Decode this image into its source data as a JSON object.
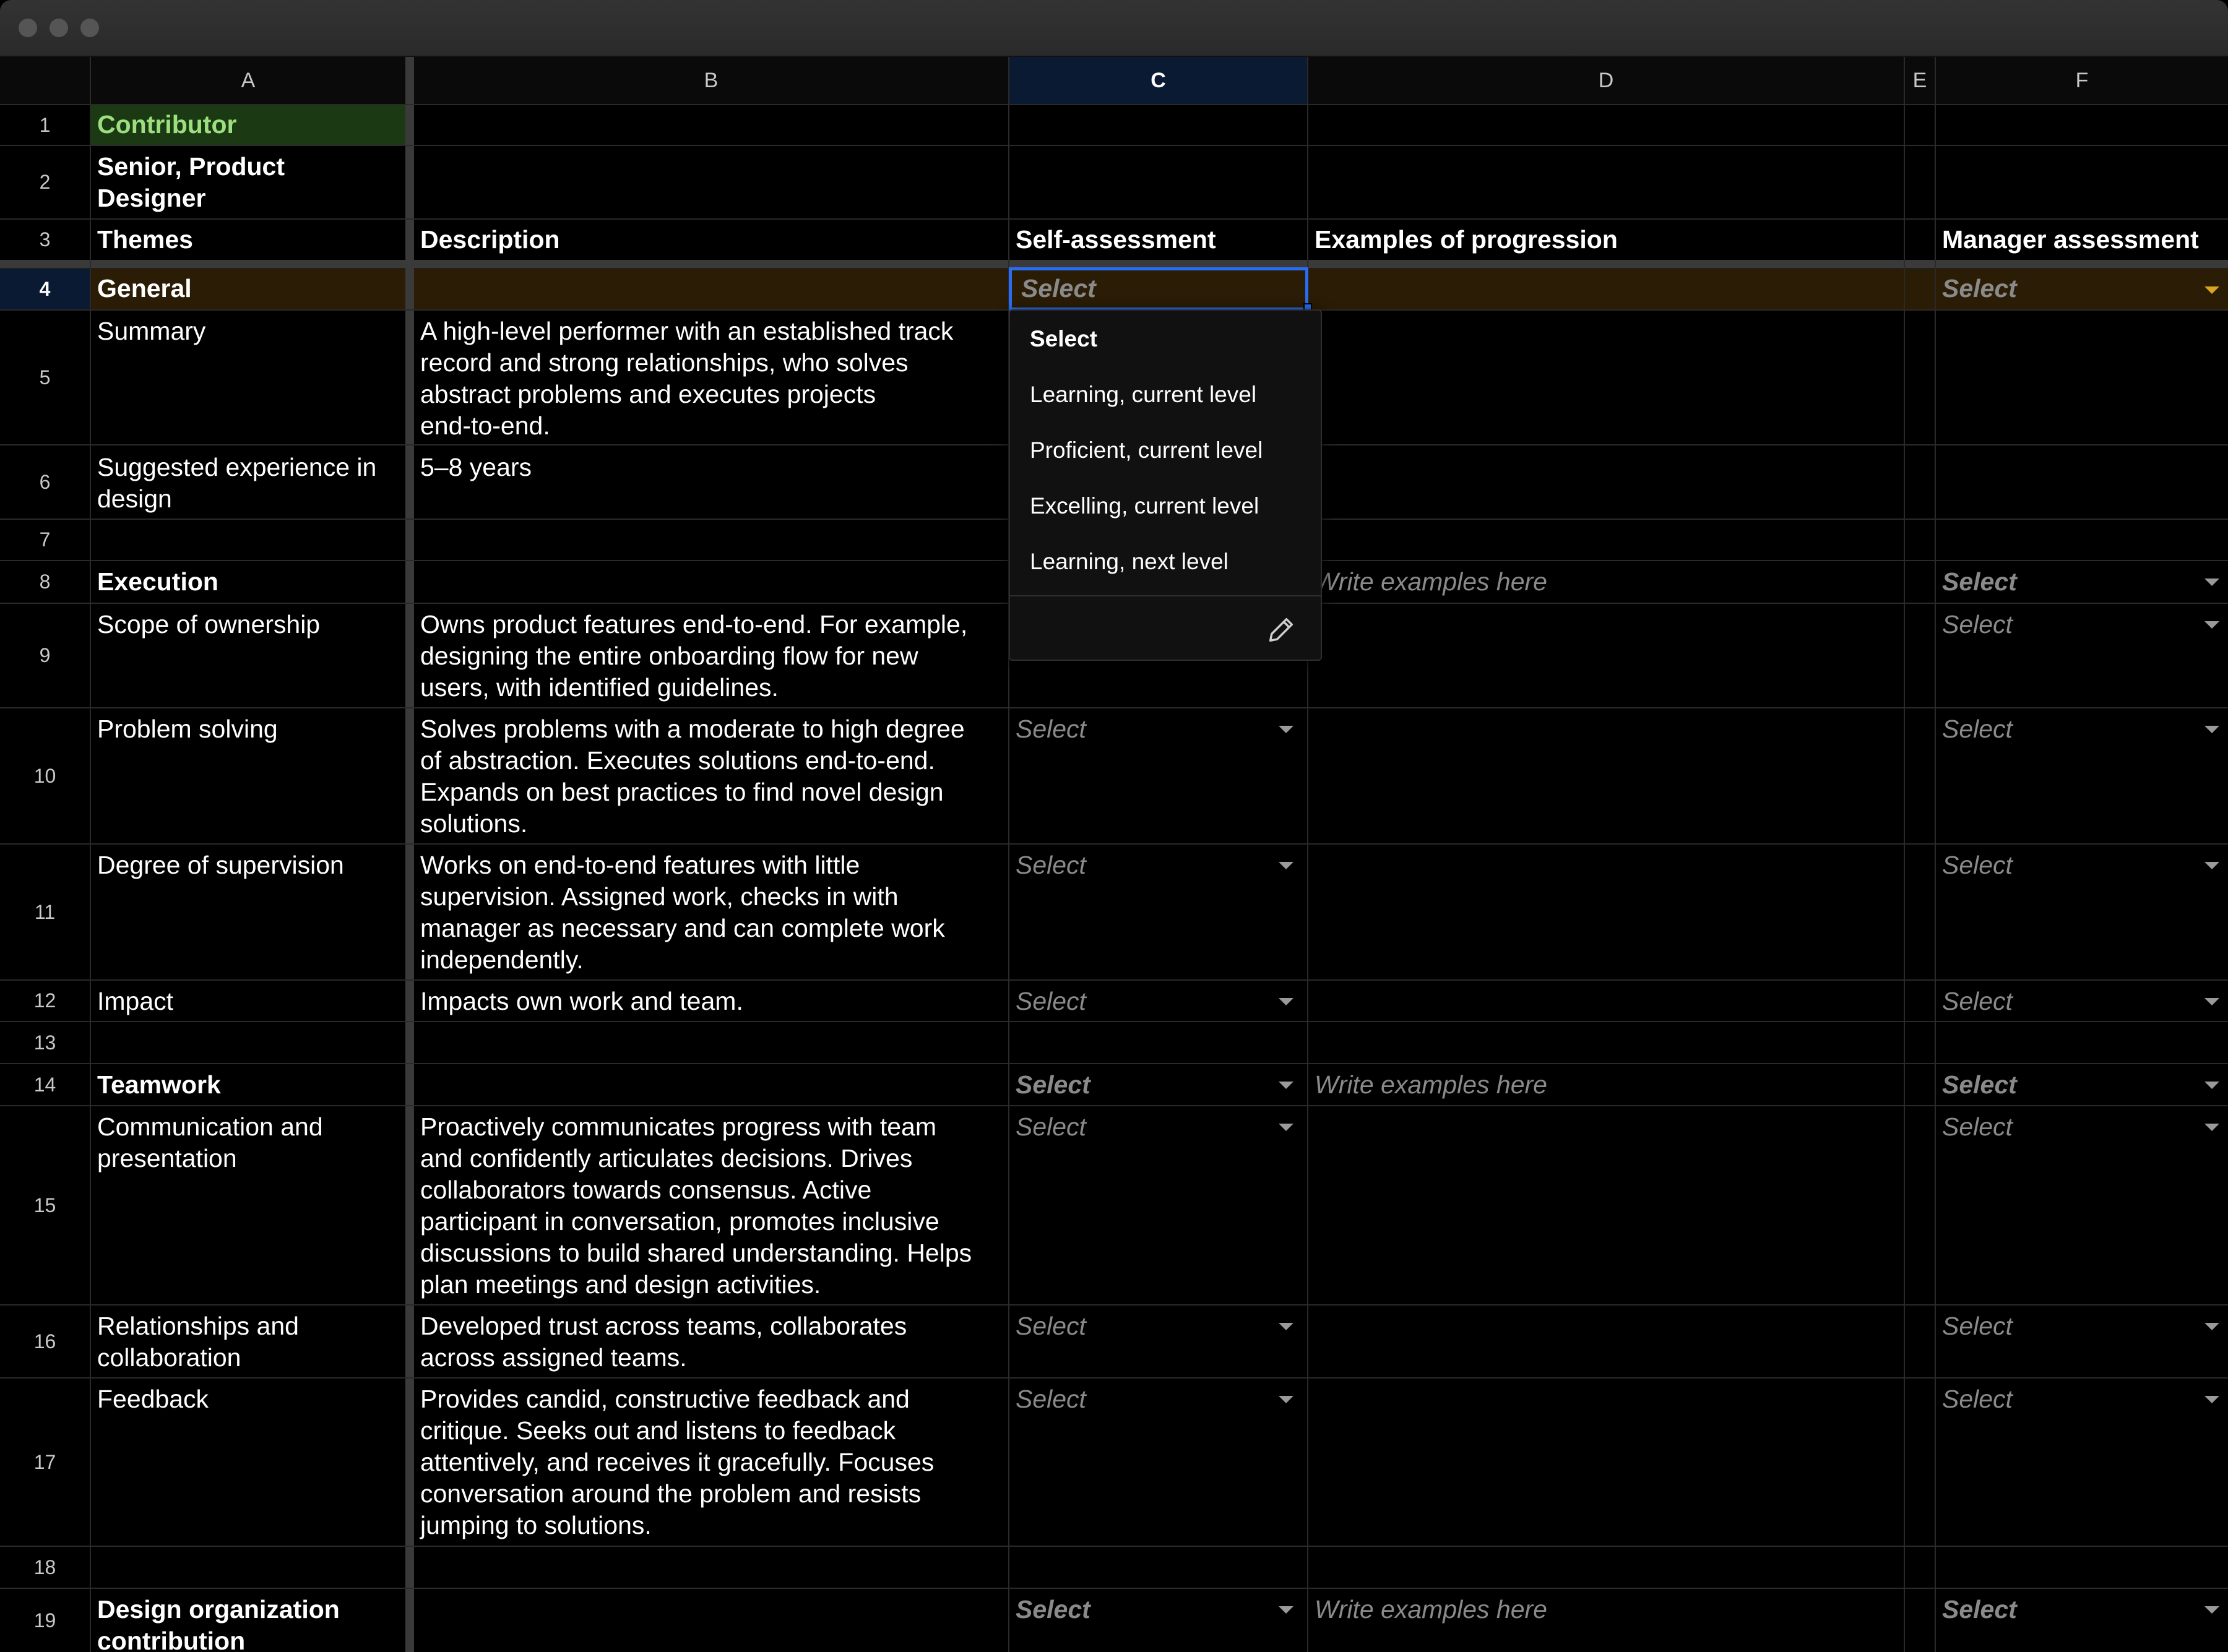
{
  "columns": [
    "A",
    "B",
    "C",
    "D",
    "E",
    "F"
  ],
  "rows": [
    "1",
    "2",
    "3",
    "4",
    "5",
    "6",
    "7",
    "8",
    "9",
    "10",
    "11",
    "12",
    "13",
    "14",
    "15",
    "16",
    "17",
    "18",
    "19"
  ],
  "header": {
    "contributor": "Contributor",
    "role_line1": "Senior, Product",
    "role_line2": "Designer",
    "themes": "Themes",
    "description": "Description",
    "self_assessment": "Self-assessment",
    "examples": "Examples of progression",
    "manager_assessment": "Manager assessment"
  },
  "placeholders": {
    "select": "Select",
    "examples": "Write examples here"
  },
  "themes": {
    "general": "General",
    "summary": "Summary",
    "experience_l1": "Suggested experience in",
    "experience_l2": "design",
    "execution": "Execution",
    "scope": "Scope of ownership",
    "problem": "Problem solving",
    "supervision": "Degree of supervision",
    "impact": "Impact",
    "teamwork": "Teamwork",
    "comm_l1": "Communication and",
    "comm_l2": "presentation",
    "rel_l1": "Relationships and",
    "rel_l2": "collaboration",
    "feedback": "Feedback",
    "org_l1": "Design organization",
    "org_l2": "contribution"
  },
  "descriptions": {
    "summary": [
      "A high-level performer with an established track",
      "record and strong relationships, who solves",
      "abstract problems and executes projects",
      "end-to-end."
    ],
    "experience": [
      "5–8 years"
    ],
    "scope": [
      "Owns product features end-to-end. For example,",
      "designing the entire onboarding flow for new",
      "users, with identified guidelines."
    ],
    "problem": [
      "Solves problems with a moderate to high degree",
      "of abstraction. Executes solutions end-to-end.",
      "Expands on best practices to find novel design",
      "solutions."
    ],
    "supervision": [
      "Works on end-to-end features with little",
      "supervision. Assigned work, checks in with",
      "manager as necessary and can complete work",
      "independently."
    ],
    "impact": [
      "Impacts own work and team."
    ],
    "comm": [
      "Proactively communicates progress with team",
      "and confidently articulates decisions. Drives",
      "collaborators towards consensus. Active",
      "participant in conversation, promotes inclusive",
      "discussions to build shared understanding. Helps",
      "plan meetings and design activities."
    ],
    "rel": [
      "Developed trust across teams, collaborates",
      "across assigned teams."
    ],
    "feedback": [
      "Provides candid, constructive feedback and",
      "critique. Seeks out and listens to feedback",
      "attentively, and receives it gracefully. Focuses",
      "conversation around the problem and resists",
      "jumping to solutions."
    ]
  },
  "dropdown": {
    "options": [
      "Select",
      "Learning, current level",
      "Proficient, current level",
      "Excelling, current level",
      "Learning, next level"
    ],
    "selected": "Select",
    "edit_icon": "pencil-icon"
  },
  "colors": {
    "section_row": "#2a1c05",
    "contributor_bg": "#1b3a14",
    "contributor_text": "#9ddf7e",
    "selection": "#2a6df5"
  }
}
